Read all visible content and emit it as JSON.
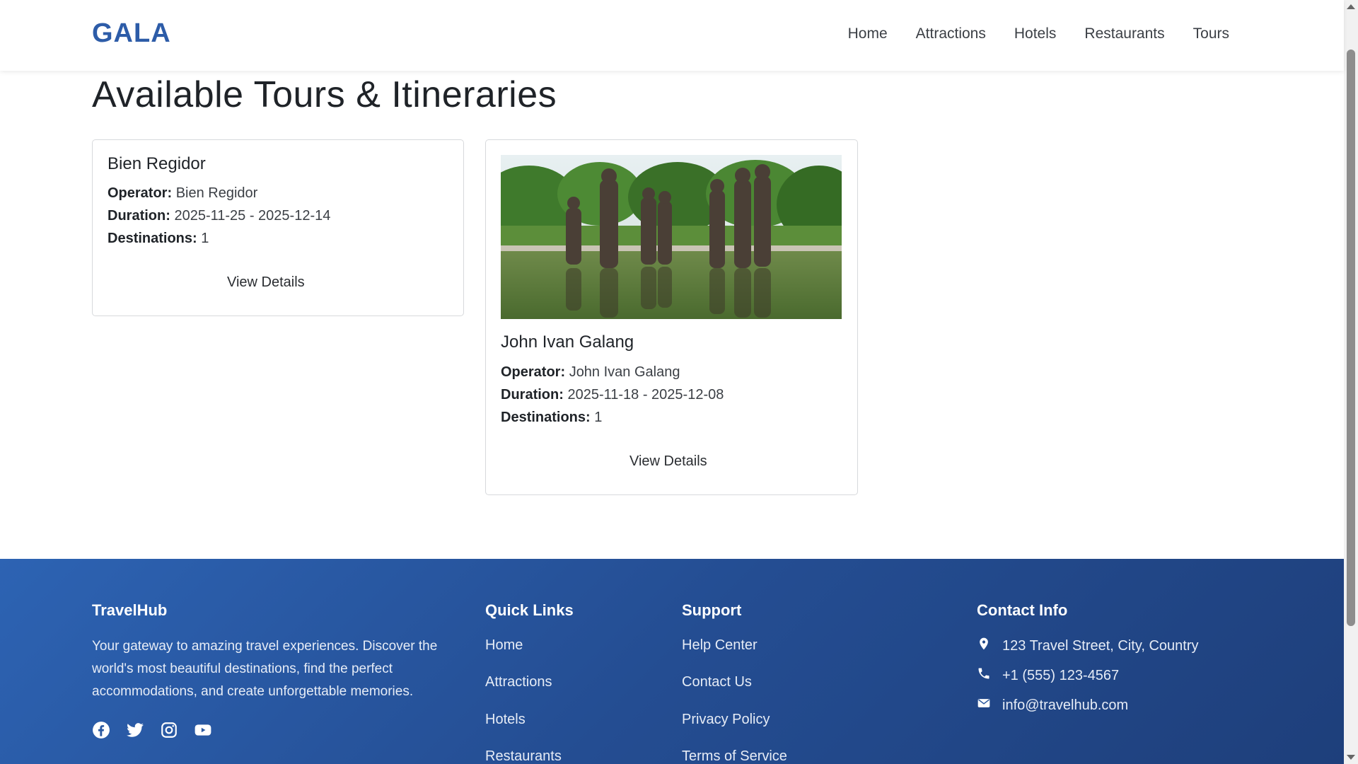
{
  "brand": "GALA",
  "nav": [
    "Home",
    "Attractions",
    "Hotels",
    "Restaurants",
    "Tours"
  ],
  "page_title": "Available Tours & Itineraries",
  "tours": [
    {
      "name": "Bien Regidor",
      "operator_label": "Operator:",
      "operator": "Bien Regidor",
      "duration_label": "Duration:",
      "duration": "2025-11-25 - 2025-12-14",
      "destinations_label": "Destinations:",
      "destinations": "1",
      "button": "View Details"
    },
    {
      "name": "John Ivan Galang",
      "operator_label": "Operator:",
      "operator": "John Ivan Galang",
      "duration_label": "Duration:",
      "duration": "2025-11-18 - 2025-12-08",
      "destinations_label": "Destinations:",
      "destinations": "1",
      "button": "View Details"
    }
  ],
  "footer": {
    "about_title": "TravelHub",
    "about_text": "Your gateway to amazing travel experiences. Discover the world's most beautiful destinations, find the perfect accommodations, and create unforgettable memories.",
    "social_icons": [
      "facebook-icon",
      "twitter-icon",
      "instagram-icon",
      "youtube-icon"
    ],
    "quick_links_title": "Quick Links",
    "quick_links": [
      "Home",
      "Attractions",
      "Hotels",
      "Restaurants"
    ],
    "support_title": "Support",
    "support_links": [
      "Help Center",
      "Contact Us",
      "Privacy Policy",
      "Terms of Service"
    ],
    "contact_title": "Contact Info",
    "contact": {
      "address": "123 Travel Street, City, Country",
      "phone": "+1 (555) 123-4567",
      "email": "info@travelhub.com"
    }
  },
  "colors": {
    "brand": "#2d5ca8",
    "footer_start": "#2d63b3",
    "footer_end": "#1e3f7b"
  }
}
